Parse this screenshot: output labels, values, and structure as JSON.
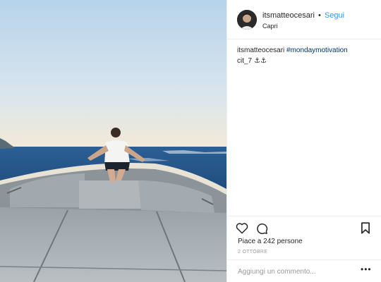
{
  "post": {
    "username": "itsmatteocesari",
    "separator": "•",
    "follow_label": "Segui",
    "location": "Capri",
    "caption": {
      "username": "itsmatteocesari",
      "hashtag": "#mondaymotivation",
      "line2": "cit_7 ⚓⚓"
    },
    "likes": "Piace a 242 persone",
    "date": "2 OTTOBRE",
    "comment_placeholder": "Aggiungi un commento...",
    "more_label": "•••"
  },
  "icons": {
    "like": "heart-icon",
    "comment": "comment-icon",
    "save": "bookmark-icon",
    "options": "more-options-icon"
  },
  "colors": {
    "link_blue": "#3897f0",
    "hashtag_blue": "#003569",
    "muted_text": "#999999",
    "divider": "#efefef"
  }
}
